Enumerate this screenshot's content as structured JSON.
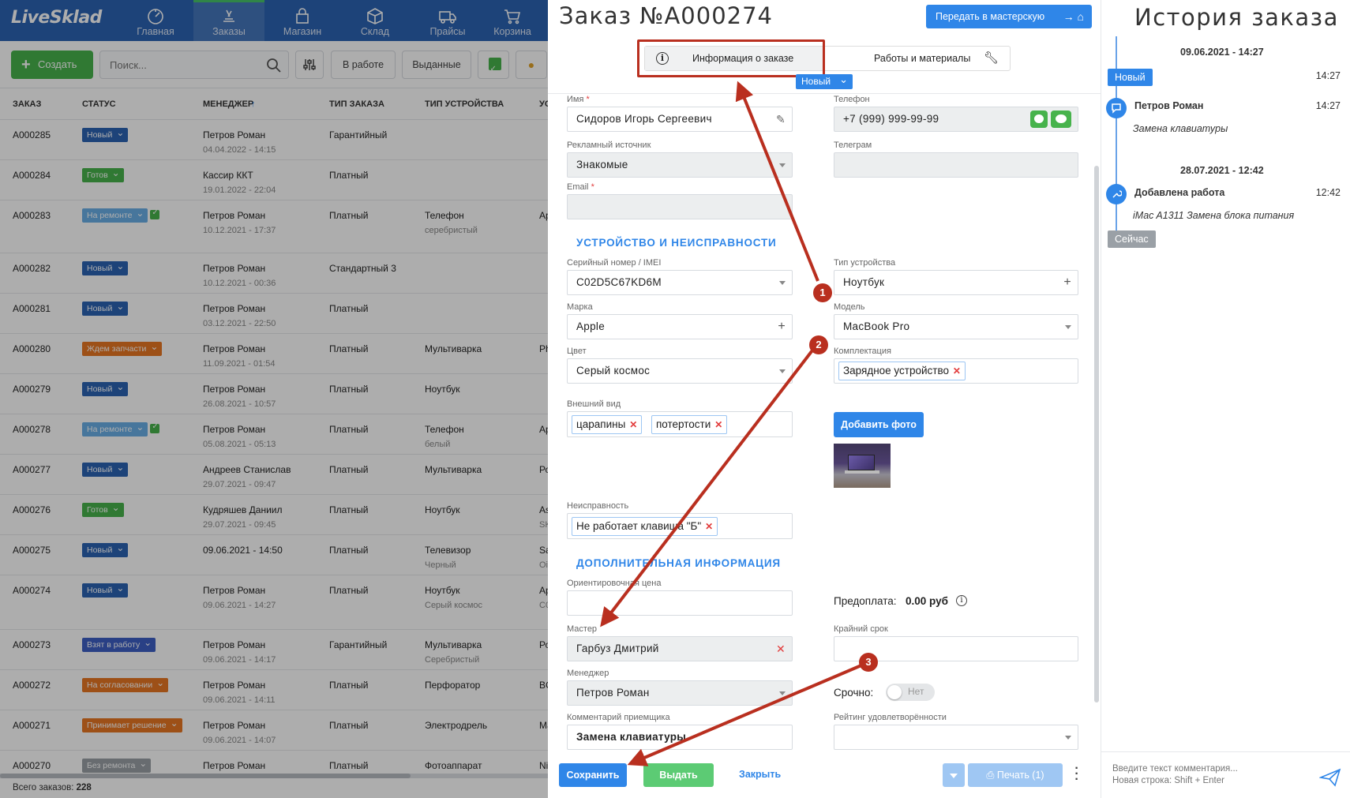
{
  "app": {
    "logo": "LiveSklad",
    "nav": [
      {
        "label": "Главная",
        "icon": "dashboard-icon"
      },
      {
        "label": "Заказы",
        "icon": "orders-icon"
      },
      {
        "label": "Магазин",
        "icon": "shop-icon"
      },
      {
        "label": "Склад",
        "icon": "warehouse-icon"
      },
      {
        "label": "Прайсы",
        "icon": "truck-icon"
      },
      {
        "label": "Корзина",
        "icon": "cart-icon"
      }
    ],
    "toolbar": {
      "create_label": "Создать",
      "search_placeholder": "Поиск...",
      "in_work_label": "В работе",
      "issued_label": "Выданные"
    },
    "table": {
      "headers": [
        "ЗАКАЗ",
        "СТАТУС",
        "МЕНЕДЖЕР",
        "ТИП ЗАКАЗА",
        "ТИП УСТРОЙСТВА",
        "УС"
      ],
      "rows": [
        {
          "id": "A000285",
          "status": "Новый",
          "status_color": "#2b63b3",
          "checked": false,
          "manager": "Петров Роман",
          "date": "04.04.2022 - 14:15",
          "type": "Гарантийный",
          "device": "",
          "device_sub": "",
          "extra": "",
          "extra_sub": ""
        },
        {
          "id": "A000284",
          "status": "Готов",
          "status_color": "#47b34c",
          "checked": false,
          "manager": "Кассир ККТ",
          "date": "19.01.2022 - 22:04",
          "type": "Платный",
          "device": "",
          "device_sub": "",
          "extra": "",
          "extra_sub": ""
        },
        {
          "id": "A000283",
          "status": "На ремонте",
          "status_color": "#69aee6",
          "checked": true,
          "manager": "Петров Роман",
          "date": "10.12.2021 - 17:37",
          "type": "Платный",
          "device": "Телефон",
          "device_sub": "серебристый",
          "extra": "Ap",
          "extra_sub": ""
        },
        {
          "id": "A000282",
          "status": "Новый",
          "status_color": "#2b63b3",
          "checked": false,
          "manager": "Петров Роман",
          "date": "10.12.2021 - 00:36",
          "type": "Стандартный 3",
          "device": "",
          "device_sub": "",
          "extra": "",
          "extra_sub": ""
        },
        {
          "id": "A000281",
          "status": "Новый",
          "status_color": "#2b63b3",
          "checked": false,
          "manager": "Петров Роман",
          "date": "03.12.2021 - 22:50",
          "type": "Платный",
          "device": "",
          "device_sub": "",
          "extra": "",
          "extra_sub": ""
        },
        {
          "id": "A000280",
          "status": "Ждем запчасти",
          "status_color": "#e87722",
          "checked": false,
          "manager": "Петров Роман",
          "date": "11.09.2021 - 01:54",
          "type": "Платный",
          "device": "Мультиварка",
          "device_sub": "",
          "extra": "Ph",
          "extra_sub": ""
        },
        {
          "id": "A000279",
          "status": "Новый",
          "status_color": "#2b63b3",
          "checked": false,
          "manager": "Петров Роман",
          "date": "26.08.2021 - 10:57",
          "type": "Платный",
          "device": "Ноутбук",
          "device_sub": "",
          "extra": "",
          "extra_sub": ""
        },
        {
          "id": "A000278",
          "status": "На ремонте",
          "status_color": "#69aee6",
          "checked": true,
          "manager": "Петров Роман",
          "date": "05.08.2021 - 05:13",
          "type": "Платный",
          "device": "Телефон",
          "device_sub": "белый",
          "extra": "Ap",
          "extra_sub": ""
        },
        {
          "id": "A000277",
          "status": "Новый",
          "status_color": "#2b63b3",
          "checked": false,
          "manager": "Андреев Станислав",
          "date": "29.07.2021 - 09:47",
          "type": "Платный",
          "device": "Мультиварка",
          "device_sub": "",
          "extra": "Ро",
          "extra_sub": ""
        },
        {
          "id": "A000276",
          "status": "Готов",
          "status_color": "#47b34c",
          "checked": false,
          "manager": "Кудряшев Даниил",
          "date": "29.07.2021 - 09:45",
          "type": "Платный",
          "device": "Ноутбук",
          "device_sub": "",
          "extra": "As",
          "extra_sub": "SK"
        },
        {
          "id": "A000275",
          "status": "Новый",
          "status_color": "#2b63b3",
          "checked": false,
          "manager": "09.06.2021 - 14:50",
          "date": "",
          "type": "Платный",
          "device": "Телевизор",
          "device_sub": "Черный",
          "extra": "Sa",
          "extra_sub": "Oi"
        },
        {
          "id": "A000274",
          "status": "Новый",
          "status_color": "#2b63b3",
          "checked": false,
          "manager": "Петров Роман",
          "date": "09.06.2021 - 14:27",
          "type": "Платный",
          "device": "Ноутбук",
          "device_sub": "Серый космос",
          "extra": "Ap",
          "extra_sub": "C0"
        },
        {
          "id": "A000273",
          "status": "Взят в работу",
          "status_color": "#3d5fc4",
          "checked": false,
          "manager": "Петров Роман",
          "date": "09.06.2021 - 14:17",
          "type": "Гарантийный",
          "device": "Мультиварка",
          "device_sub": "Серебристый",
          "extra": "Ро",
          "extra_sub": ""
        },
        {
          "id": "A000272",
          "status": "На согласовании",
          "status_color": "#e87722",
          "checked": false,
          "manager": "Петров Роман",
          "date": "09.06.2021 - 14:11",
          "type": "Платный",
          "device": "Перфоратор",
          "device_sub": "",
          "extra": "BC",
          "extra_sub": ""
        },
        {
          "id": "A000271",
          "status": "Принимает решение",
          "status_color": "#e87722",
          "checked": false,
          "manager": "Петров Роман",
          "date": "09.06.2021 - 14:07",
          "type": "Платный",
          "device": "Электродрель",
          "device_sub": "",
          "extra": "Ма",
          "extra_sub": ""
        },
        {
          "id": "A000270",
          "status": "Без ремонта",
          "status_color": "#9aa0a6",
          "checked": false,
          "manager": "Петров Роман",
          "date": "",
          "type": "Платный",
          "device": "Фотоаппарат",
          "device_sub": "",
          "extra": "Ni",
          "extra_sub": ""
        }
      ],
      "total_label": "Всего заказов:",
      "total_value": "228"
    }
  },
  "order": {
    "title": "Заказ №A000274",
    "transfer_label": "Передать в мастерскую",
    "tab_info": "Информация о заказе",
    "tab_works": "Работы и материалы",
    "status": "Новый",
    "name_label": "Имя",
    "name_value": "Сидоров Игорь Сергеевич",
    "phone_label": "Телефон",
    "phone_value": "+7 (999) 999-99-99",
    "ad_label": "Рекламный источник",
    "ad_value": "Знакомые",
    "telegram_label": "Телеграм",
    "telegram_value": "",
    "email_label": "Email",
    "email_value": "",
    "section_device": "УСТРОЙСТВО И НЕИСПРАВНОСТИ",
    "serial_label": "Серийный номер / IMEI",
    "serial_value": "C02D5C67KD6M",
    "device_type_label": "Тип устройства",
    "device_type_value": "Ноутбук",
    "brand_label": "Марка",
    "brand_value": "Apple",
    "model_label": "Модель",
    "model_value": "MacBook Pro",
    "color_label": "Цвет",
    "color_value": "Серый космос",
    "kit_label": "Комплектация",
    "kit_tags": [
      "Зарядное устройство"
    ],
    "appearance_label": "Внешний вид",
    "appearance_tags": [
      "царапины",
      "потертости"
    ],
    "add_photo_label": "Добавить фото",
    "defect_label": "Неисправность",
    "defect_tags": [
      "Не работает клавиша \"Б\""
    ],
    "section_extra": "ДОПОЛНИТЕЛЬНАЯ ИНФОРМАЦИЯ",
    "price_label": "Ориентировочная цена",
    "price_value": "",
    "prepay_label": "Предоплата:",
    "prepay_value": "0.00 руб",
    "master_label": "Мастер",
    "master_value": "Гарбуз Дмитрий",
    "deadline_label": "Крайний срок",
    "deadline_value": "",
    "manager_label": "Менеджер",
    "manager_value": "Петров Роман",
    "urgent_label": "Срочно:",
    "urgent_value": "Нет",
    "comment_label": "Комментарий приемщика",
    "comment_value": "Замена клавиатуры",
    "rating_label": "Рейтинг удовлетворённости",
    "rating_value": "",
    "save_label": "Сохранить",
    "issue_label": "Выдать",
    "close_label": "Закрыть",
    "print_label": "Печать (1)"
  },
  "history": {
    "title": "История заказа",
    "date1": "09.06.2021 - 14:27",
    "event1_status": "Новый",
    "event1_time": "14:27",
    "event2_name": "Петров Роман",
    "event2_time": "14:27",
    "event2_note": "Замена клавиатуры",
    "date2": "28.07.2021 - 12:42",
    "event3_name": "Добавлена работа",
    "event3_time": "12:42",
    "event3_note": "iMac A1311 Замена блока питания",
    "now_label": "Сейчас",
    "comment_placeholder": "Введите текст комментария...\nНовая строка: Shift + Enter"
  },
  "annotations": {
    "markers": [
      "1",
      "2",
      "3"
    ],
    "color": "#b92f1f"
  }
}
